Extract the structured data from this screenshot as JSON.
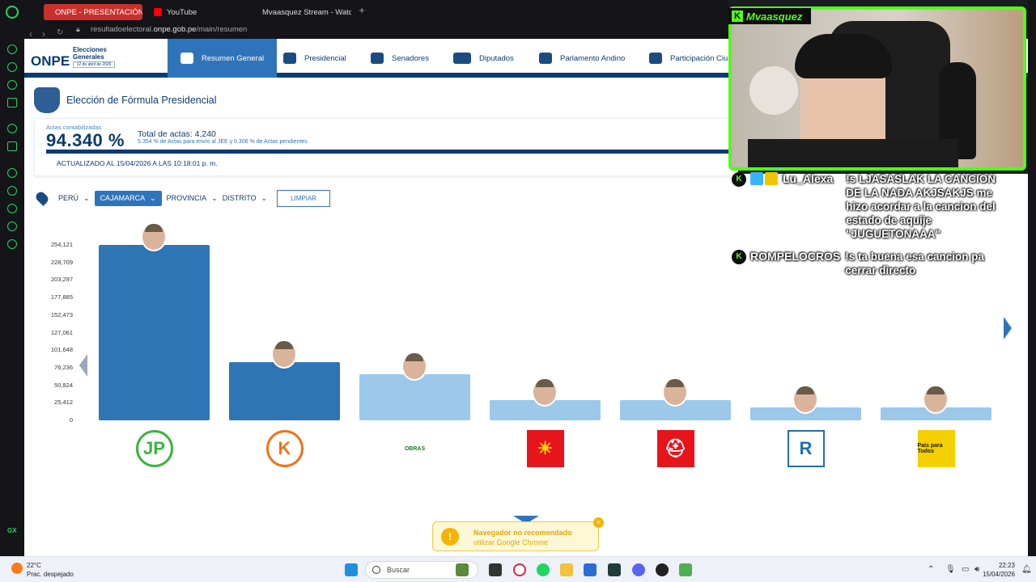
{
  "browser": {
    "tabs": [
      {
        "label": "ONPE - PRESENTACIÓN D",
        "color": "#ffffff"
      },
      {
        "label": "YouTube",
        "color": "#ff0000"
      },
      {
        "label": "Mvaasquez Stream - Watc",
        "color": "#53fc18"
      }
    ],
    "new_tab": "+",
    "url_prefix": "resultadoelectoral.",
    "url_domain": "onpe.gob.pe",
    "url_path": "/main/resumen"
  },
  "onpe": {
    "logo": "ONPE",
    "logo_sub": "Elecciones Generales",
    "logo_date": "12 de abril de 2026",
    "nav": [
      "Resumen General",
      "Presidencial",
      "Senadores",
      "Diputados",
      "Parlamento Andino",
      "Participación Ciu"
    ],
    "page_title": "Elección de Fórmula Presidencial",
    "actas_label": "Actas contabilizadas",
    "actas_pct": "94.340 %",
    "total_actas": "Total de actas: 4,240",
    "pending_note": "5.354 % de Actas para envío al JEE y 0.306 % de Actas pendientes",
    "updated": "ACTUALIZADO AL 15/04/2026 A LAS 10:18:01 p. m.",
    "filters": {
      "peru": "PERÚ",
      "region": "CAJAMARCA",
      "provincia": "PROVINCIA",
      "distrito": "DISTRITO",
      "clear": "LIMPIAR"
    }
  },
  "chart_data": {
    "type": "bar",
    "yticks": [
      "254,121",
      "228,709",
      "203,297",
      "177,885",
      "152,473",
      "127,061",
      "101,648",
      "76,236",
      "50,824",
      "25,412",
      "0"
    ],
    "ylim": [
      0,
      254121
    ],
    "categories": [
      "JP",
      "K",
      "OBRAS",
      "SOL",
      "HELMET",
      "R",
      "País para Todos"
    ],
    "values": [
      254121,
      84000,
      67000,
      29000,
      29000,
      19000,
      19000
    ],
    "colors": [
      "#2e75b6",
      "#2e75b6",
      "#9cc8ea",
      "#9cc8ea",
      "#9cc8ea",
      "#9cc8ea",
      "#9cc8ea"
    ],
    "logo_texts": [
      "JP",
      "K",
      "OBRAS",
      "☀",
      "⛑",
      "R",
      "País para Todos"
    ],
    "logo_bgs": [
      "#ffffff",
      "#ffffff",
      "#ffffff",
      "#e8141c",
      "#e8141c",
      "#ffffff",
      "#f5d000"
    ],
    "logo_fgs": [
      "#3cb43c",
      "#f07318",
      "#1c7a2e",
      "#ffd400",
      "#ffffff",
      "#1d6fb8",
      "#1a1a1a"
    ]
  },
  "toast": {
    "title": "Navegador no recomendado",
    "body": "utilizar Google Chrome",
    "icon": "warning-icon"
  },
  "stream": {
    "streamer": "Mvaasquez",
    "chat": [
      {
        "user": "Lu_Alexa",
        "message": "!s LJASASLAK LA CANCION DE LA NADA AKJSAKJS me hizo acordar a la cancion del estado de aquije \"JUGUETONAAA\""
      },
      {
        "user": "ROMPELOCROS",
        "message": "!s ta buena esa cancion pa cerrar directo"
      }
    ]
  },
  "taskbar": {
    "temp": "22°C",
    "weather": "Prac. despejado",
    "search": "Buscar",
    "time": "22:23",
    "date": "15/04/2026"
  }
}
